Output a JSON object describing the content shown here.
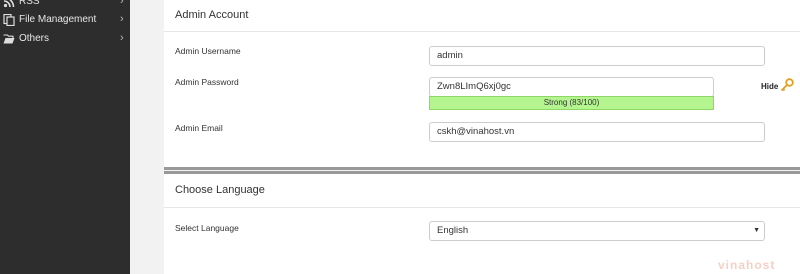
{
  "sidebar": {
    "items": [
      {
        "label": "RSS",
        "icon": "rss-icon"
      },
      {
        "label": "File Management",
        "icon": "file-icon"
      },
      {
        "label": "Others",
        "icon": "folder-open-icon"
      }
    ]
  },
  "admin_account": {
    "title": "Admin Account",
    "username_label": "Admin Username",
    "username_value": "admin",
    "password_label": "Admin Password",
    "password_value": "Zwn8LImQ6xj0gc",
    "strength_text": "Strong (83/100)",
    "strength_fraction": 0.83,
    "hide_label": "Hide",
    "email_label": "Admin Email",
    "email_value": "cskh@vinahost.vn"
  },
  "language": {
    "title": "Choose Language",
    "select_label": "Select Language",
    "selected": "English"
  },
  "watermark": "vinahost",
  "colors": {
    "sidebar_bg": "#2d2d2d",
    "strength_bar": "#b5f58f",
    "key_icon": "#e0a020"
  }
}
